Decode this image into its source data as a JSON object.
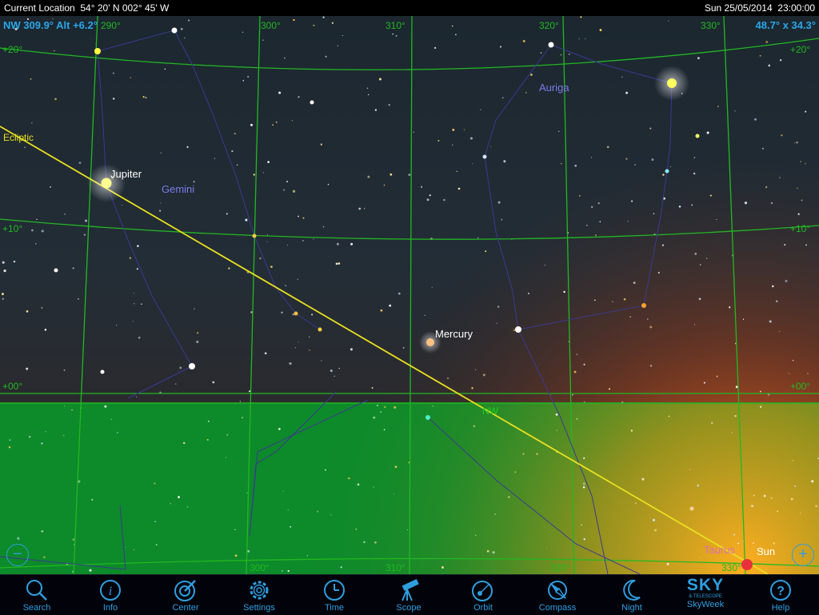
{
  "status": {
    "location": "Current Location  54° 20' N 002° 45' W",
    "datetime": "Sun 25/05/2014  23:00:00"
  },
  "hud": {
    "direction": "NW 309.9° Alt +6.2°",
    "fov": "48.7° x 34.3°"
  },
  "grid": {
    "top_azimuths": [
      "290°",
      "300°",
      "310°",
      "320°",
      "330°"
    ],
    "bottom_azimuths": [
      "300°",
      "310°",
      "320°",
      "330°"
    ],
    "altitudes_left": [
      "+20°",
      "+10°",
      "+00°"
    ],
    "altitudes_right": [
      "+20°",
      "+10°",
      "+00°"
    ],
    "horizon_label": "NW",
    "ecliptic_label": "Ecliptic"
  },
  "labels": {
    "jupiter": "Jupiter",
    "gemini": "Gemini",
    "auriga": "Auriga",
    "mercury": "Mercury",
    "taurus": "Taurus",
    "sun": "Sun"
  },
  "colors": {
    "grid": "#22b822",
    "ecliptic": "#e8e020",
    "constellation_name": "#7c7ce8",
    "hud": "#2aa6e8",
    "toolbar_icon": "#2f9ee0",
    "horizon_fill": "#0d8a2a"
  },
  "toolbar": [
    {
      "label": "Search",
      "icon": "search-icon"
    },
    {
      "label": "Info",
      "icon": "info-icon"
    },
    {
      "label": "Center",
      "icon": "center-icon"
    },
    {
      "label": "Settings",
      "icon": "gear-icon"
    },
    {
      "label": "Time",
      "icon": "clock-icon"
    },
    {
      "label": "Scope",
      "icon": "telescope-icon"
    },
    {
      "label": "Orbit",
      "icon": "orbit-icon"
    },
    {
      "label": "Compass",
      "icon": "compass-icon"
    },
    {
      "label": "Night",
      "icon": "moon-icon"
    },
    {
      "label": "SkyWeek",
      "icon": "skyweek-logo-icon",
      "logo_text": "SKY",
      "logo_subtext": "& TELESCOPE"
    },
    {
      "label": "Help",
      "icon": "help-icon"
    }
  ],
  "zoom": {
    "minus": "−",
    "plus": "+"
  }
}
